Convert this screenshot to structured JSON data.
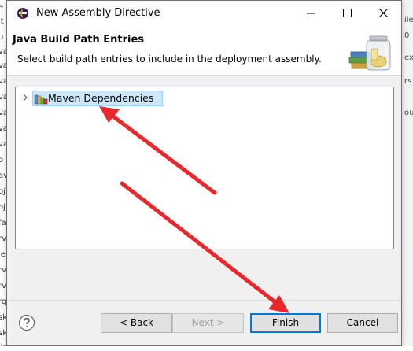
{
  "window": {
    "title": "New Assembly Directive",
    "icon": "eclipse-icon",
    "controls": {
      "minimize": "minimize-icon",
      "maximize": "maximize-icon",
      "close": "close-icon"
    }
  },
  "banner": {
    "title": "Java Build Path Entries",
    "description": "Select build path entries to include in the deployment assembly.",
    "image": "library-jar-icon"
  },
  "entries": {
    "items": [
      {
        "label": "Maven Dependencies",
        "icon": "library-icon",
        "expanded": false,
        "selected": true
      }
    ]
  },
  "footer": {
    "help_icon": "help-icon",
    "back_label": "< Back",
    "next_label": "Next >",
    "finish_label": "Finish",
    "cancel_label": "Cancel"
  },
  "annotations": {
    "arrow_color": "#e8282b"
  },
  "colors": {
    "selection_bg": "#cce8ff",
    "selection_border": "#99d1ff",
    "default_button_border": "#0078d7"
  }
}
